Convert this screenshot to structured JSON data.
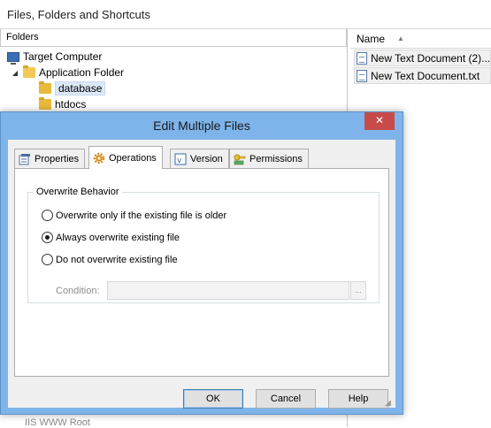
{
  "app": {
    "title": "Files, Folders and Shortcuts",
    "folders_header": "Folders",
    "tree": [
      {
        "label": "Target Computer",
        "icon": "computer-icon",
        "expander": ""
      },
      {
        "label": "Application Folder",
        "icon": "folder-icon",
        "expander": "◢"
      },
      {
        "label": "database",
        "icon": "folder-icon",
        "expander": "",
        "selected": true
      },
      {
        "label": "htdocs",
        "icon": "folder-icon",
        "expander": ""
      }
    ],
    "partial_bottom_item": "IIS WWW Root",
    "files_header": "Name",
    "files": [
      {
        "name": "New Text Document (2)..."
      },
      {
        "name": "New Text Document.txt"
      }
    ]
  },
  "dialog": {
    "title": "Edit Multiple Files",
    "close_glyph": "✕",
    "tabs": [
      {
        "label": "Properties",
        "icon": "properties-icon"
      },
      {
        "label": "Operations",
        "icon": "gear-icon",
        "active": true
      },
      {
        "label": "Version",
        "icon": "version-icon"
      },
      {
        "label": "Permissions",
        "icon": "key-icon"
      }
    ],
    "group_label": "Overwrite Behavior",
    "options": [
      {
        "label": "Overwrite only if the existing file is older",
        "checked": false
      },
      {
        "label": "Always overwrite existing file",
        "checked": true
      },
      {
        "label": "Do not overwrite existing file",
        "checked": false
      }
    ],
    "condition_label": "Condition:",
    "condition_value": "",
    "browse_glyph": "...",
    "buttons": {
      "ok": "OK",
      "cancel": "Cancel",
      "help": "Help"
    }
  },
  "colors": {
    "dialog_frame": "#7eb4ea",
    "close_button": "#c74b4b",
    "selection": "#dbe8f7"
  }
}
